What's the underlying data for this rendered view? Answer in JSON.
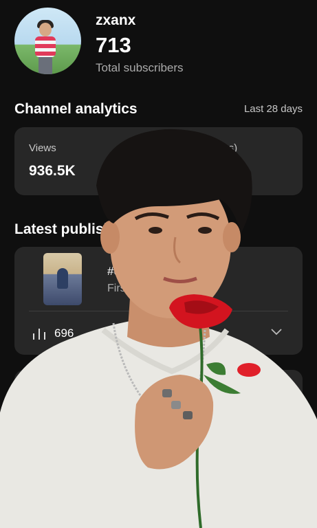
{
  "header": {
    "channel_name": "zxanx",
    "subscriber_count": "713",
    "subscriber_label": "Total subscribers"
  },
  "analytics": {
    "title": "Channel analytics",
    "period": "Last 28 days",
    "views_label": "Views",
    "views_value": "936.5K",
    "watch_time_label": "Watch time (hours)"
  },
  "latest": {
    "title": "Latest published",
    "item": {
      "title": "#comedy 😁 #entert…",
      "time": "First 11 minutes",
      "views": "696"
    }
  },
  "icons": {
    "views_stat": "bar-chart-icon",
    "expand": "chevron-down-icon"
  },
  "colors": {
    "background": "#0f0f0f",
    "card": "#272727",
    "rose": "#d3141f"
  }
}
